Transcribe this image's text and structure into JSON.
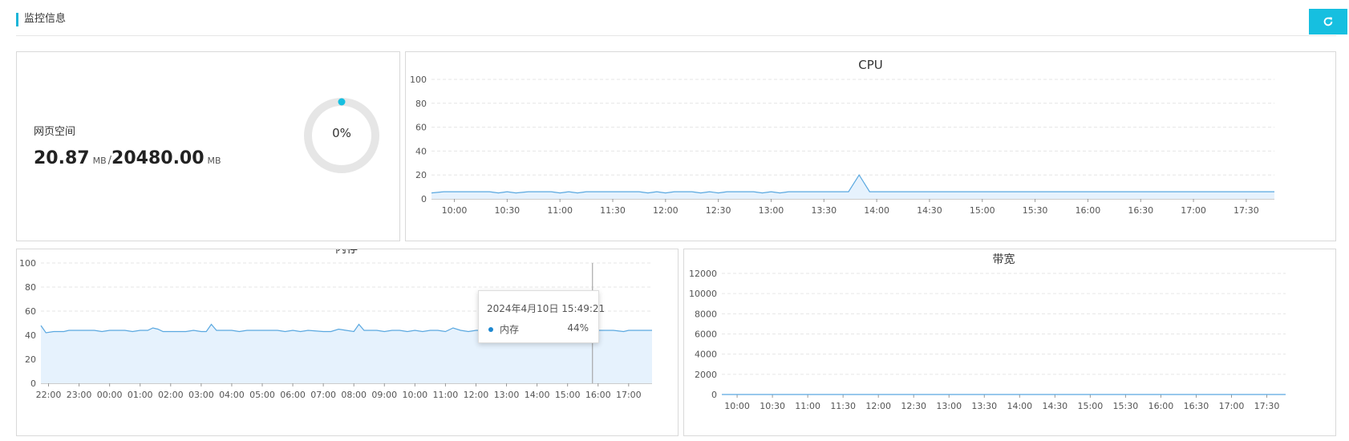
{
  "header": {
    "title": "监控信息"
  },
  "toolbar": {
    "refresh_icon": "refresh-icon"
  },
  "space": {
    "label": "网页空间",
    "used": "20.87",
    "used_unit": "MB",
    "separator": "/",
    "total": "20480.00",
    "total_unit": "MB",
    "percent_text": "0%",
    "percent_value": 0
  },
  "colors": {
    "accent": "#16bfe0",
    "line": "#5aa8e0",
    "fill": "#e6f2fd",
    "grid": "#e8e8e8",
    "gauge_track": "#e6e6e6"
  },
  "tooltip": {
    "title": "2024年4月10日 15:49:21",
    "series_name": "内存",
    "value": "44%"
  },
  "chart_data": [
    {
      "id": "cpu",
      "type": "area",
      "title": "CPU",
      "ylim": [
        0,
        100
      ],
      "yticks": [
        0,
        20,
        40,
        60,
        80,
        100
      ],
      "xlim": [
        "09:47",
        "17:46"
      ],
      "xticks": [
        "10:00",
        "10:30",
        "11:00",
        "11:30",
        "12:00",
        "12:30",
        "13:00",
        "13:30",
        "14:00",
        "14:30",
        "15:00",
        "15:30",
        "16:00",
        "16:30",
        "17:00",
        "17:30"
      ],
      "series": [
        {
          "points": [
            [
              "09:47",
              5
            ],
            [
              "09:54",
              6
            ],
            [
              "10:10",
              6
            ],
            [
              "10:20",
              6
            ],
            [
              "10:25",
              5
            ],
            [
              "10:30",
              6
            ],
            [
              "10:35",
              5
            ],
            [
              "10:42",
              6
            ],
            [
              "10:55",
              6
            ],
            [
              "11:00",
              5
            ],
            [
              "11:05",
              6
            ],
            [
              "11:10",
              5
            ],
            [
              "11:15",
              6
            ],
            [
              "11:30",
              6
            ],
            [
              "11:45",
              6
            ],
            [
              "11:50",
              5
            ],
            [
              "11:55",
              6
            ],
            [
              "12:00",
              5
            ],
            [
              "12:05",
              6
            ],
            [
              "12:15",
              6
            ],
            [
              "12:20",
              5
            ],
            [
              "12:25",
              6
            ],
            [
              "12:30",
              5
            ],
            [
              "12:35",
              6
            ],
            [
              "12:50",
              6
            ],
            [
              "12:55",
              5
            ],
            [
              "13:00",
              6
            ],
            [
              "13:05",
              5
            ],
            [
              "13:10",
              6
            ],
            [
              "13:20",
              6
            ],
            [
              "13:40",
              6
            ],
            [
              "13:44",
              6
            ],
            [
              "13:50",
              20
            ],
            [
              "13:56",
              6
            ],
            [
              "14:30",
              6
            ],
            [
              "15:30",
              6
            ],
            [
              "16:30",
              6
            ],
            [
              "17:30",
              6
            ],
            [
              "17:46",
              6
            ]
          ]
        }
      ]
    },
    {
      "id": "memory",
      "type": "area",
      "title": "内存",
      "ylim": [
        0,
        100
      ],
      "yticks": [
        0,
        20,
        40,
        60,
        80,
        100
      ],
      "xlim": [
        "21:45",
        "17:46"
      ],
      "xticks": [
        "22:00",
        "23:00",
        "00:00",
        "01:00",
        "02:00",
        "03:00",
        "04:00",
        "05:00",
        "06:00",
        "07:00",
        "08:00",
        "09:00",
        "10:00",
        "11:00",
        "12:00",
        "13:00",
        "14:00",
        "15:00",
        "16:00",
        "17:00"
      ],
      "series": [
        {
          "name": "内存",
          "points": [
            [
              "21:45",
              48
            ],
            [
              "21:55",
              42
            ],
            [
              "22:10",
              43
            ],
            [
              "22:30",
              43
            ],
            [
              "22:40",
              44
            ],
            [
              "23:00",
              44
            ],
            [
              "23:30",
              44
            ],
            [
              "23:45",
              43
            ],
            [
              "00:00",
              44
            ],
            [
              "00:30",
              44
            ],
            [
              "00:45",
              43
            ],
            [
              "01:00",
              44
            ],
            [
              "01:15",
              44
            ],
            [
              "01:25",
              46
            ],
            [
              "01:35",
              45
            ],
            [
              "01:45",
              43
            ],
            [
              "02:00",
              43
            ],
            [
              "02:30",
              43
            ],
            [
              "02:45",
              44
            ],
            [
              "03:00",
              43
            ],
            [
              "03:10",
              43
            ],
            [
              "03:20",
              49
            ],
            [
              "03:30",
              44
            ],
            [
              "04:00",
              44
            ],
            [
              "04:15",
              43
            ],
            [
              "04:30",
              44
            ],
            [
              "05:00",
              44
            ],
            [
              "05:30",
              44
            ],
            [
              "05:45",
              43
            ],
            [
              "06:00",
              44
            ],
            [
              "06:15",
              43
            ],
            [
              "06:30",
              44
            ],
            [
              "07:00",
              43
            ],
            [
              "07:15",
              43
            ],
            [
              "07:30",
              45
            ],
            [
              "07:45",
              44
            ],
            [
              "08:00",
              43
            ],
            [
              "08:10",
              49
            ],
            [
              "08:20",
              44
            ],
            [
              "08:45",
              44
            ],
            [
              "09:00",
              43
            ],
            [
              "09:15",
              44
            ],
            [
              "09:30",
              44
            ],
            [
              "09:45",
              43
            ],
            [
              "10:00",
              44
            ],
            [
              "10:15",
              43
            ],
            [
              "10:30",
              44
            ],
            [
              "10:45",
              44
            ],
            [
              "11:00",
              43
            ],
            [
              "11:15",
              46
            ],
            [
              "11:30",
              44
            ],
            [
              "11:45",
              43
            ],
            [
              "12:00",
              44
            ],
            [
              "12:15",
              44
            ],
            [
              "12:30",
              45
            ],
            [
              "13:00",
              45
            ],
            [
              "13:15",
              44
            ],
            [
              "13:30",
              45
            ],
            [
              "13:40",
              44
            ],
            [
              "13:55",
              49
            ],
            [
              "14:05",
              44
            ],
            [
              "14:20",
              43
            ],
            [
              "14:35",
              44
            ],
            [
              "14:45",
              44
            ],
            [
              "15:00",
              44
            ],
            [
              "15:49",
              44
            ],
            [
              "16:00",
              44
            ],
            [
              "16:30",
              44
            ],
            [
              "16:50",
              43
            ],
            [
              "17:00",
              44
            ],
            [
              "17:46",
              44
            ]
          ]
        }
      ],
      "cursor_x": "15:49"
    },
    {
      "id": "bandwidth",
      "type": "area",
      "title": "带宽",
      "ylim": [
        0,
        12000
      ],
      "yticks": [
        0,
        2000,
        4000,
        6000,
        8000,
        10000,
        12000
      ],
      "xlim": [
        "09:47",
        "17:46"
      ],
      "xticks": [
        "10:00",
        "10:30",
        "11:00",
        "11:30",
        "12:00",
        "12:30",
        "13:00",
        "13:30",
        "14:00",
        "14:30",
        "15:00",
        "15:30",
        "16:00",
        "16:30",
        "17:00",
        "17:30"
      ],
      "series": [
        {
          "points": [
            [
              "09:47",
              0
            ],
            [
              "17:46",
              0
            ]
          ]
        }
      ]
    }
  ]
}
